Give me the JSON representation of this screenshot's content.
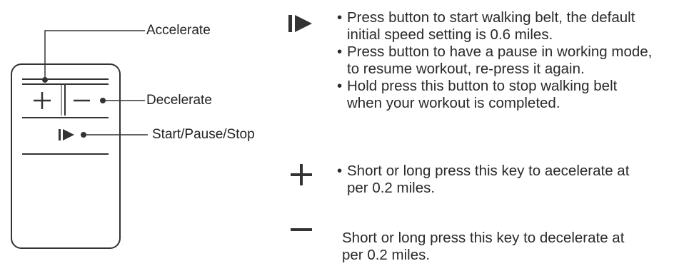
{
  "remote": {
    "callouts": {
      "accelerate": "Accelerate",
      "decelerate": "Decelerate",
      "start_pause_stop": "Start/Pause/Stop"
    },
    "buttons": {
      "plus": "+",
      "minus": "−"
    },
    "icons": [
      "play-pause-icon",
      "plus-icon",
      "minus-icon"
    ]
  },
  "instructions": {
    "play_pause": [
      {
        "bullet": "•",
        "lines": [
          "Press button to start walking belt, the default",
          "initial speed setting is 0.6 miles."
        ]
      },
      {
        "bullet": "•",
        "lines": [
          "Press button to have a pause in working mode,",
          "to resume workout, re-press it again."
        ]
      },
      {
        "bullet": "•",
        "lines": [
          "Hold press this button to stop walking belt",
          "when your workout is completed."
        ]
      }
    ],
    "accelerate": [
      {
        "bullet": "•",
        "lines": [
          "Short or long press this key to aecelerate at",
          "per 0.2 miles."
        ]
      }
    ],
    "decelerate": [
      {
        "bullet": "",
        "lines": [
          "Short or long press this key to decelerate at",
          "per 0.2 miles."
        ]
      }
    ]
  },
  "colors": {
    "ink": "#222222",
    "line": "#3a3a3a"
  }
}
